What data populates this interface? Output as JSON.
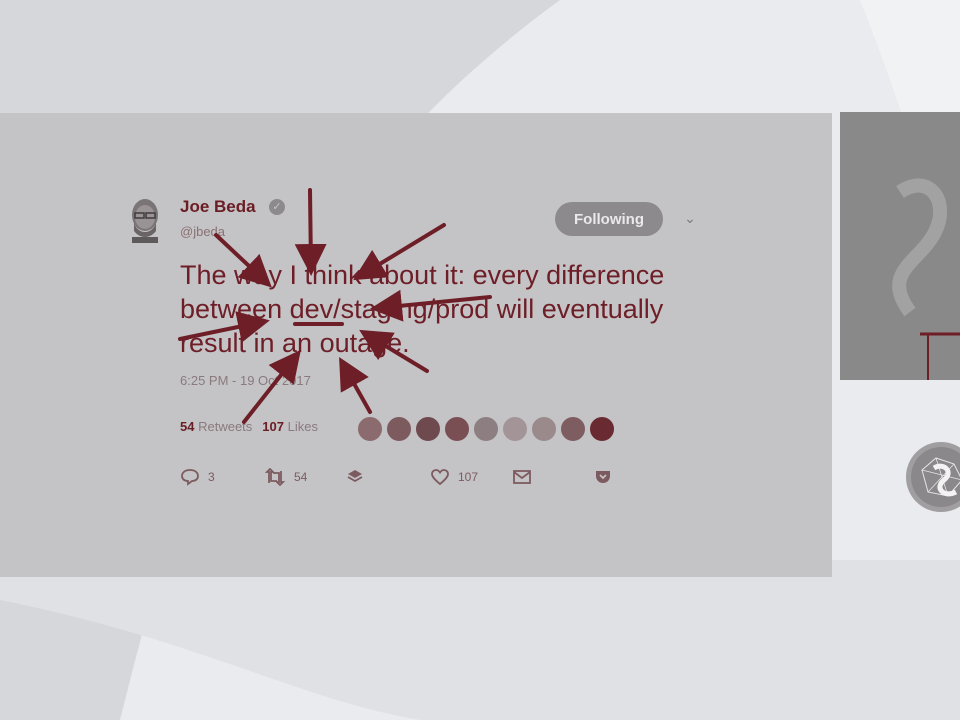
{
  "tweet": {
    "author": {
      "display_name": "Joe Beda",
      "handle": "@jbeda",
      "verified_icon": "verified-badge-icon",
      "verified_glyph": "✓"
    },
    "follow_button_label": "Following",
    "menu_icon": "chevron-down-icon",
    "menu_glyph": "⌄",
    "text": "The way I think about it: every difference between dev/staging/prod will eventually result in an outage.",
    "timestamp": "6:25 PM - 19 Oct 2017",
    "stats": {
      "retweets_count": "54",
      "retweets_label": "Retweets",
      "likes_count": "107",
      "likes_label": "Likes"
    },
    "actions": {
      "reply_count": "3",
      "retweet_count": "54",
      "like_count": "107"
    }
  },
  "colors": {
    "card_bg": "#c4c3c5",
    "annotation": "#6d1e27",
    "button_bg": "#8d8a8d"
  }
}
